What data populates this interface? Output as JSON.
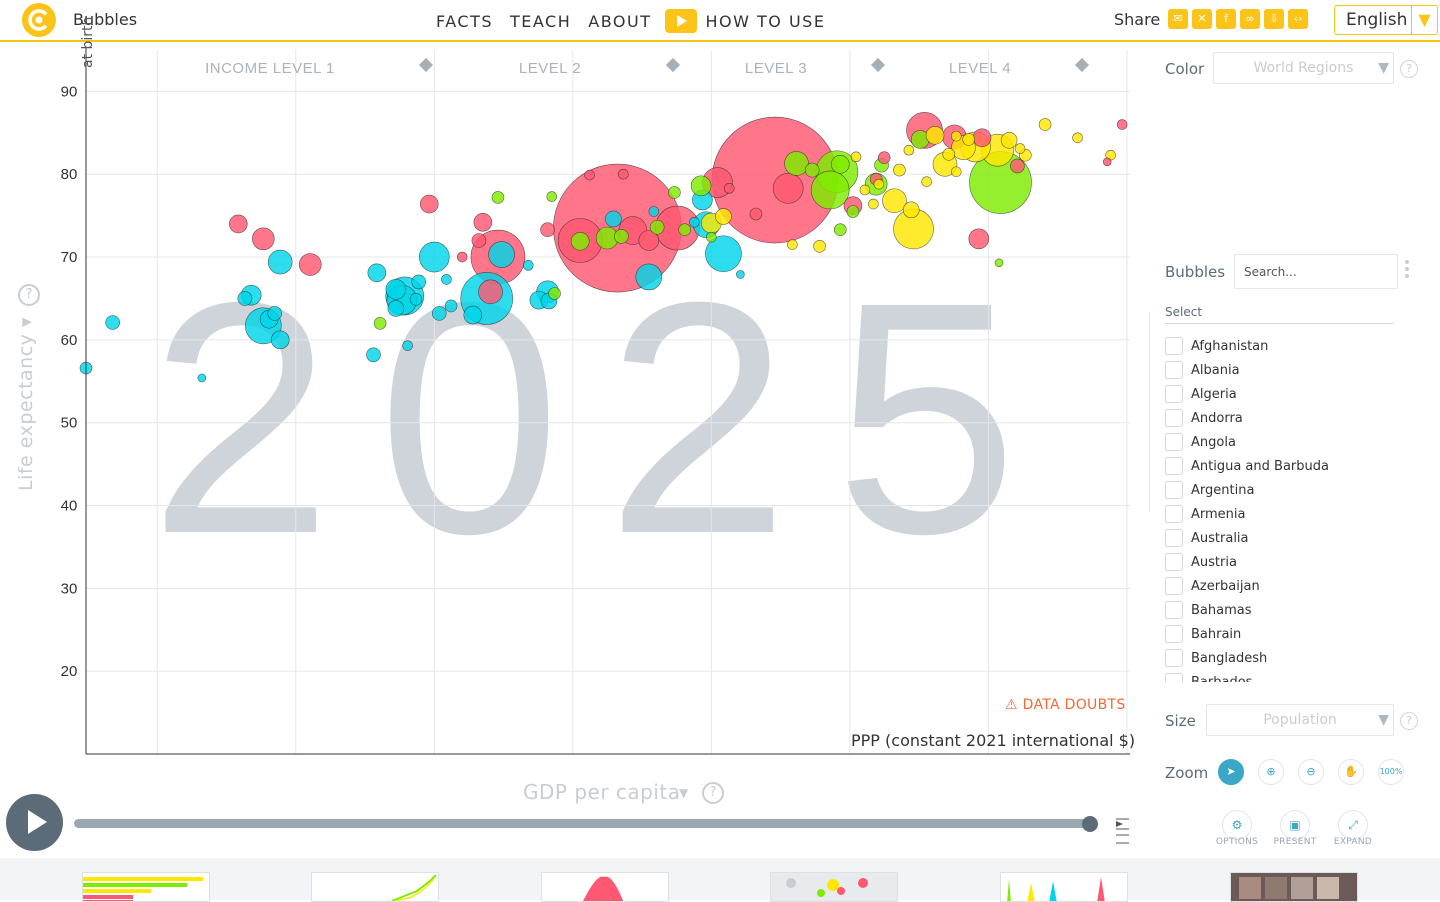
{
  "header": {
    "app_title": "Bubbles",
    "nav": [
      "FACTS",
      "TEACH",
      "ABOUT",
      "HOW TO USE"
    ],
    "share_label": "Share",
    "share_icons": [
      "mail-icon",
      "twitter-icon",
      "facebook-icon",
      "link-icon",
      "download-icon",
      "embed-icon"
    ],
    "language": "English"
  },
  "chart": {
    "year": "2025",
    "y_title": "Life expectancy",
    "y_subtitle": "at birth",
    "x_title": "GDP per capita",
    "x_unit": "PPP (constant 2021 international $)",
    "data_doubts": "DATA DOUBTS",
    "income_levels": [
      "INCOME LEVEL 1",
      "LEVEL 2",
      "LEVEL 3",
      "LEVEL 4"
    ],
    "colors": {
      "asia": "#ff5872",
      "africa": "#00d5e9",
      "europe": "#ffe700",
      "americas": "#7feb00",
      "year": "#ccd2d8"
    }
  },
  "chart_data": {
    "type": "scatter",
    "xscale": "log",
    "xlim": [
      700,
      130000
    ],
    "ylim": [
      10,
      95
    ],
    "x_ticks": [
      "1000",
      "2000",
      "4000",
      "8000",
      "16k",
      "32k",
      "64k",
      "128k"
    ],
    "y_ticks": [
      20,
      30,
      40,
      50,
      60,
      70,
      80,
      90
    ],
    "grid": true,
    "points": [
      {
        "x": 10000,
        "y": 73.5,
        "r": 64,
        "c": "asia"
      },
      {
        "x": 22000,
        "y": 79.3,
        "r": 63,
        "c": "asia"
      },
      {
        "x": 13500,
        "y": 73.5,
        "r": 22,
        "c": "asia"
      },
      {
        "x": 8300,
        "y": 72,
        "r": 22,
        "c": "asia"
      },
      {
        "x": 10800,
        "y": 73.2,
        "r": 14,
        "c": "asia"
      },
      {
        "x": 11700,
        "y": 72,
        "r": 10,
        "c": "asia"
      },
      {
        "x": 5500,
        "y": 70,
        "r": 27,
        "c": "asia"
      },
      {
        "x": 5300,
        "y": 65.8,
        "r": 12,
        "c": "asia"
      },
      {
        "x": 5100,
        "y": 74.2,
        "r": 9,
        "c": "asia"
      },
      {
        "x": 5000,
        "y": 72,
        "r": 7,
        "c": "asia"
      },
      {
        "x": 4600,
        "y": 70,
        "r": 5,
        "c": "asia"
      },
      {
        "x": 1500,
        "y": 74,
        "r": 9,
        "c": "asia"
      },
      {
        "x": 1700,
        "y": 72.2,
        "r": 11,
        "c": "asia"
      },
      {
        "x": 2150,
        "y": 69.1,
        "r": 11,
        "c": "asia"
      },
      {
        "x": 3900,
        "y": 76.4,
        "r": 9,
        "c": "asia"
      },
      {
        "x": 7050,
        "y": 73.3,
        "r": 7,
        "c": "asia"
      },
      {
        "x": 8700,
        "y": 79.9,
        "r": 5,
        "c": "asia"
      },
      {
        "x": 10300,
        "y": 80,
        "r": 5,
        "c": "asia"
      },
      {
        "x": 16500,
        "y": 79,
        "r": 15,
        "c": "asia"
      },
      {
        "x": 20000,
        "y": 75.2,
        "r": 6,
        "c": "asia"
      },
      {
        "x": 17500,
        "y": 78.3,
        "r": 5,
        "c": "asia"
      },
      {
        "x": 23500,
        "y": 78.3,
        "r": 15,
        "c": "asia"
      },
      {
        "x": 32500,
        "y": 76.2,
        "r": 9,
        "c": "asia"
      },
      {
        "x": 36500,
        "y": 79.4,
        "r": 6,
        "c": "asia"
      },
      {
        "x": 38000,
        "y": 82,
        "r": 6,
        "c": "asia"
      },
      {
        "x": 46500,
        "y": 85.3,
        "r": 18,
        "c": "asia"
      },
      {
        "x": 54000,
        "y": 84.5,
        "r": 12,
        "c": "asia"
      },
      {
        "x": 61000,
        "y": 72.2,
        "r": 10,
        "c": "asia"
      },
      {
        "x": 62000,
        "y": 84.4,
        "r": 9,
        "c": "asia"
      },
      {
        "x": 74000,
        "y": 81,
        "r": 7,
        "c": "asia"
      },
      {
        "x": 125000,
        "y": 86,
        "r": 5,
        "c": "asia"
      },
      {
        "x": 116000,
        "y": 81.5,
        "r": 4,
        "c": "asia"
      },
      {
        "x": 5200,
        "y": 65,
        "r": 26,
        "c": "africa"
      },
      {
        "x": 5600,
        "y": 70.3,
        "r": 13,
        "c": "africa"
      },
      {
        "x": 4000,
        "y": 70,
        "r": 15,
        "c": "africa"
      },
      {
        "x": 3450,
        "y": 65.3,
        "r": 19,
        "c": "africa"
      },
      {
        "x": 3400,
        "y": 64.8,
        "r": 15,
        "c": "africa"
      },
      {
        "x": 3300,
        "y": 66.1,
        "r": 10,
        "c": "africa"
      },
      {
        "x": 3300,
        "y": 63.8,
        "r": 8,
        "c": "africa"
      },
      {
        "x": 3000,
        "y": 68.1,
        "r": 9,
        "c": "africa"
      },
      {
        "x": 1700,
        "y": 61.7,
        "r": 18,
        "c": "africa"
      },
      {
        "x": 1600,
        "y": 65.4,
        "r": 10,
        "c": "africa"
      },
      {
        "x": 1550,
        "y": 65,
        "r": 7,
        "c": "africa"
      },
      {
        "x": 1750,
        "y": 62.5,
        "r": 9,
        "c": "africa"
      },
      {
        "x": 1800,
        "y": 63.2,
        "r": 7,
        "c": "africa"
      },
      {
        "x": 1850,
        "y": 60,
        "r": 9,
        "c": "africa"
      },
      {
        "x": 1850,
        "y": 69.4,
        "r": 12,
        "c": "africa"
      },
      {
        "x": 800,
        "y": 62.1,
        "r": 7,
        "c": "africa"
      },
      {
        "x": 700,
        "y": 56.6,
        "r": 6,
        "c": "africa"
      },
      {
        "x": 1250,
        "y": 55.4,
        "r": 4,
        "c": "africa"
      },
      {
        "x": 2950,
        "y": 58.2,
        "r": 7,
        "c": "africa"
      },
      {
        "x": 3500,
        "y": 59.3,
        "r": 5,
        "c": "africa"
      },
      {
        "x": 4100,
        "y": 63.2,
        "r": 7,
        "c": "africa"
      },
      {
        "x": 4350,
        "y": 64.1,
        "r": 6,
        "c": "africa"
      },
      {
        "x": 4850,
        "y": 63,
        "r": 9,
        "c": "africa"
      },
      {
        "x": 3650,
        "y": 64.9,
        "r": 6,
        "c": "africa"
      },
      {
        "x": 3700,
        "y": 67,
        "r": 7,
        "c": "africa"
      },
      {
        "x": 6750,
        "y": 64.8,
        "r": 9,
        "c": "africa"
      },
      {
        "x": 7050,
        "y": 65.8,
        "r": 11,
        "c": "africa"
      },
      {
        "x": 7100,
        "y": 64.7,
        "r": 8,
        "c": "africa"
      },
      {
        "x": 4250,
        "y": 67.3,
        "r": 5,
        "c": "africa"
      },
      {
        "x": 6400,
        "y": 69,
        "r": 5,
        "c": "africa"
      },
      {
        "x": 11700,
        "y": 67.6,
        "r": 13,
        "c": "africa"
      },
      {
        "x": 17000,
        "y": 70.4,
        "r": 18,
        "c": "africa"
      },
      {
        "x": 12000,
        "y": 75.5,
        "r": 5,
        "c": "africa"
      },
      {
        "x": 15300,
        "y": 76.9,
        "r": 10,
        "c": "africa"
      },
      {
        "x": 15600,
        "y": 73.9,
        "r": 13,
        "c": "africa"
      },
      {
        "x": 9800,
        "y": 74.6,
        "r": 8,
        "c": "africa"
      },
      {
        "x": 14700,
        "y": 74.2,
        "r": 5,
        "c": "africa"
      },
      {
        "x": 18500,
        "y": 67.9,
        "r": 4,
        "c": "africa"
      },
      {
        "x": 30000,
        "y": 80.3,
        "r": 21,
        "c": "americas"
      },
      {
        "x": 29000,
        "y": 78.1,
        "r": 19,
        "c": "americas"
      },
      {
        "x": 68000,
        "y": 79,
        "r": 31,
        "c": "americas"
      },
      {
        "x": 9500,
        "y": 72.3,
        "r": 11,
        "c": "americas"
      },
      {
        "x": 10200,
        "y": 72.5,
        "r": 7,
        "c": "americas"
      },
      {
        "x": 8300,
        "y": 71.9,
        "r": 9,
        "c": "americas"
      },
      {
        "x": 12200,
        "y": 73.6,
        "r": 7,
        "c": "americas"
      },
      {
        "x": 14000,
        "y": 73.3,
        "r": 6,
        "c": "americas"
      },
      {
        "x": 15200,
        "y": 78.6,
        "r": 10,
        "c": "americas"
      },
      {
        "x": 13300,
        "y": 77.8,
        "r": 6,
        "c": "americas"
      },
      {
        "x": 16000,
        "y": 72.4,
        "r": 5,
        "c": "americas"
      },
      {
        "x": 24500,
        "y": 81.3,
        "r": 12,
        "c": "americas"
      },
      {
        "x": 26500,
        "y": 80.5,
        "r": 7,
        "c": "americas"
      },
      {
        "x": 30500,
        "y": 81.2,
        "r": 9,
        "c": "americas"
      },
      {
        "x": 36500,
        "y": 78.8,
        "r": 11,
        "c": "americas"
      },
      {
        "x": 37500,
        "y": 81.1,
        "r": 7,
        "c": "americas"
      },
      {
        "x": 32500,
        "y": 75.5,
        "r": 6,
        "c": "americas"
      },
      {
        "x": 30500,
        "y": 73.3,
        "r": 6,
        "c": "americas"
      },
      {
        "x": 5500,
        "y": 77.2,
        "r": 6,
        "c": "americas"
      },
      {
        "x": 7200,
        "y": 77.3,
        "r": 5,
        "c": "americas"
      },
      {
        "x": 3050,
        "y": 62,
        "r": 6,
        "c": "americas"
      },
      {
        "x": 45500,
        "y": 84.2,
        "r": 9,
        "c": "americas"
      },
      {
        "x": 67500,
        "y": 69.3,
        "r": 4,
        "c": "americas"
      },
      {
        "x": 7300,
        "y": 65.6,
        "r": 6,
        "c": "americas"
      },
      {
        "x": 40000,
        "y": 76.8,
        "r": 12,
        "c": "europe"
      },
      {
        "x": 44000,
        "y": 73.4,
        "r": 20,
        "c": "europe"
      },
      {
        "x": 43500,
        "y": 75.7,
        "r": 8,
        "c": "europe"
      },
      {
        "x": 56500,
        "y": 83.2,
        "r": 12,
        "c": "europe"
      },
      {
        "x": 60000,
        "y": 83.3,
        "r": 15,
        "c": "europe"
      },
      {
        "x": 51500,
        "y": 81.2,
        "r": 12,
        "c": "europe"
      },
      {
        "x": 67000,
        "y": 82.9,
        "r": 16,
        "c": "europe"
      },
      {
        "x": 71000,
        "y": 84.1,
        "r": 8,
        "c": "europe"
      },
      {
        "x": 49000,
        "y": 84.7,
        "r": 9,
        "c": "europe"
      },
      {
        "x": 58000,
        "y": 84.2,
        "r": 6,
        "c": "europe"
      },
      {
        "x": 54500,
        "y": 84.6,
        "r": 5,
        "c": "europe"
      },
      {
        "x": 43000,
        "y": 82.9,
        "r": 5,
        "c": "europe"
      },
      {
        "x": 41000,
        "y": 80.5,
        "r": 6,
        "c": "europe"
      },
      {
        "x": 47000,
        "y": 79.1,
        "r": 5,
        "c": "europe"
      },
      {
        "x": 37000,
        "y": 78.8,
        "r": 5,
        "c": "europe"
      },
      {
        "x": 34500,
        "y": 78.1,
        "r": 5,
        "c": "europe"
      },
      {
        "x": 36000,
        "y": 76.4,
        "r": 5,
        "c": "europe"
      },
      {
        "x": 24000,
        "y": 71.5,
        "r": 5,
        "c": "europe"
      },
      {
        "x": 16000,
        "y": 74.1,
        "r": 10,
        "c": "europe"
      },
      {
        "x": 17000,
        "y": 74.9,
        "r": 8,
        "c": "europe"
      },
      {
        "x": 85000,
        "y": 86,
        "r": 6,
        "c": "europe"
      },
      {
        "x": 100000,
        "y": 84.4,
        "r": 5,
        "c": "europe"
      },
      {
        "x": 118000,
        "y": 82.3,
        "r": 5,
        "c": "europe"
      },
      {
        "x": 77000,
        "y": 82.3,
        "r": 6,
        "c": "europe"
      },
      {
        "x": 75000,
        "y": 83.1,
        "r": 5,
        "c": "europe"
      },
      {
        "x": 54500,
        "y": 80.3,
        "r": 5,
        "c": "europe"
      },
      {
        "x": 52500,
        "y": 82.4,
        "r": 6,
        "c": "europe"
      },
      {
        "x": 33000,
        "y": 82.1,
        "r": 5,
        "c": "europe"
      },
      {
        "x": 27500,
        "y": 71.3,
        "r": 6,
        "c": "europe"
      }
    ]
  },
  "panel": {
    "color_label": "Color",
    "color_value": "World Regions",
    "bubbles_label": "Bubbles",
    "search_placeholder": "Search...",
    "select_heading": "Select",
    "countries": [
      "Afghanistan",
      "Albania",
      "Algeria",
      "Andorra",
      "Angola",
      "Antigua and Barbuda",
      "Argentina",
      "Armenia",
      "Australia",
      "Austria",
      "Azerbaijan",
      "Bahamas",
      "Bahrain",
      "Bangladesh",
      "Barbados"
    ],
    "size_label": "Size",
    "size_value": "Population",
    "zoom_label": "Zoom",
    "zoom_100": "100%",
    "options_label": "OPTIONS",
    "present_label": "PRESENT",
    "expand_label": "EXPAND"
  }
}
